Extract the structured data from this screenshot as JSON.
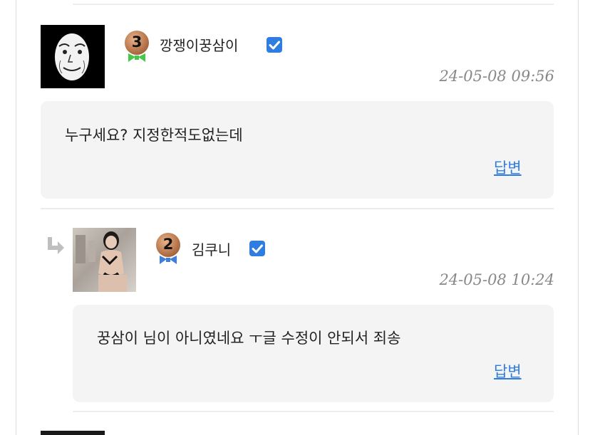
{
  "comments": [
    {
      "nickname": "깡쟁이꿍삼이",
      "level": "3",
      "timestamp": "24-05-08 09:56",
      "text": "누구세요? 지정한적도없는데",
      "reply_label": "답변",
      "badge_bow_color": "#45c84a",
      "avatar": "meme-face-avatar"
    },
    {
      "nickname": "김쿠니",
      "level": "2",
      "timestamp": "24-05-08 10:24",
      "text": "꿍삼이 님이 아니였네요 ㅜ글 수정이 안되서 죄송",
      "reply_label": "답변",
      "badge_bow_color": "#3f7fd8",
      "avatar": "photo-avatar",
      "is_reply": true
    }
  ],
  "colors": {
    "verified": "#2f7de1",
    "link": "#2f7de1",
    "bubble_bg": "#f4f4f4",
    "timestamp": "#888888"
  }
}
